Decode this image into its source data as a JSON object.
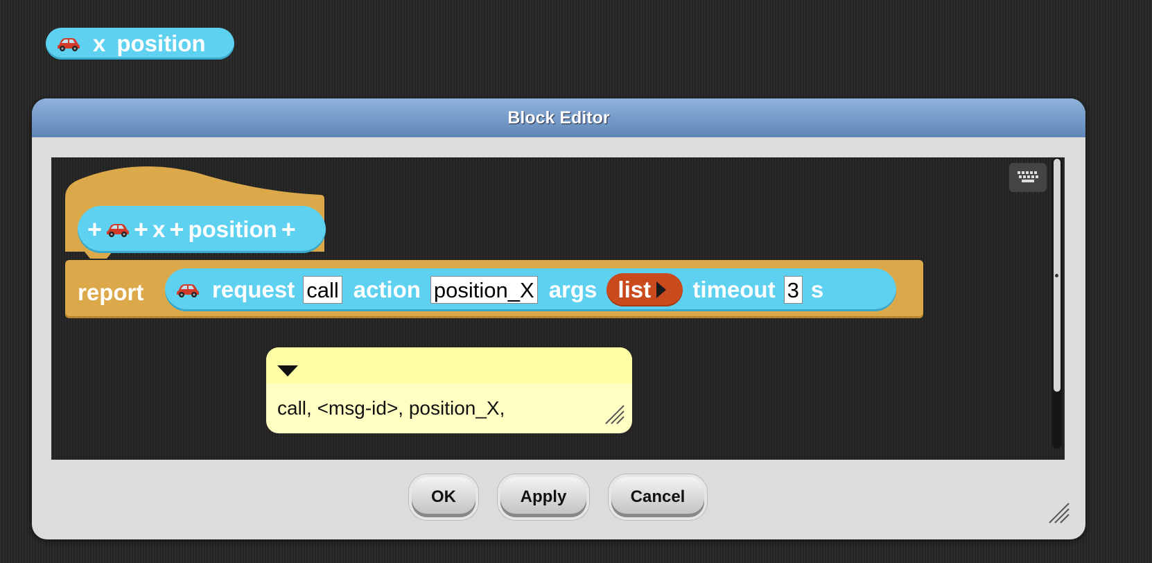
{
  "palette_block": {
    "icon": "car-icon",
    "word1": "x",
    "word2": "position",
    "color": "#5fd1f0"
  },
  "dialog": {
    "title": "Block Editor",
    "keyboard_icon": "keyboard-icon",
    "prototype": {
      "plus": "+",
      "icon": "car-icon",
      "word1": "x",
      "word2": "position"
    },
    "report_label": "report",
    "request_block": {
      "icon": "car-icon",
      "request_label": "request",
      "request_value": "call",
      "action_label": "action",
      "action_value": "position_X",
      "args_label": "args",
      "list_label": "list",
      "timeout_label": "timeout",
      "timeout_value": "3",
      "unit_label": "s"
    },
    "comment": {
      "text": "call, <msg-id>, position_X,"
    },
    "buttons": {
      "ok": "OK",
      "apply": "Apply",
      "cancel": "Cancel"
    }
  },
  "colors": {
    "sensing_block": "#5fd1f0",
    "hat_block": "#dba84a",
    "list_block": "#c94a1c",
    "comment_bg": "#ffffc4",
    "titlebar": "#6f96c6"
  }
}
